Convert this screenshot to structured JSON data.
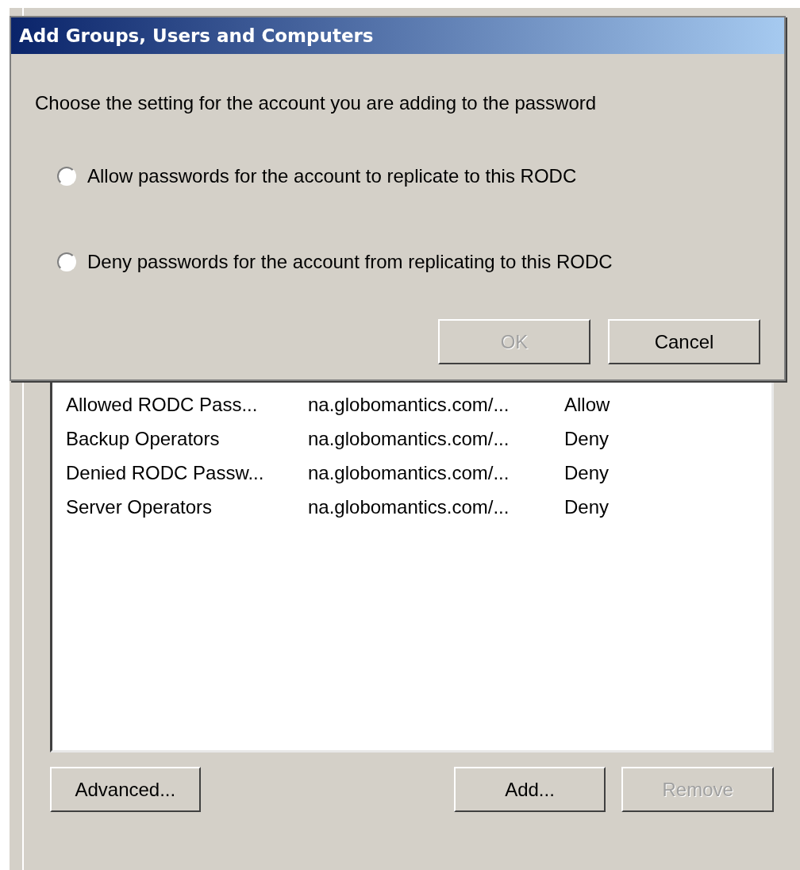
{
  "dialog": {
    "title": "Add Groups, Users and Computers",
    "prompt": "Choose the setting for the account you are adding to the password",
    "options": [
      {
        "label": "Allow passwords for the account to replicate to this RODC",
        "selected": false
      },
      {
        "label": "Deny passwords for the account from replicating to this RODC",
        "selected": false
      }
    ],
    "buttons": [
      {
        "label": "OK",
        "disabled": true
      },
      {
        "label": "Cancel",
        "disabled": false
      }
    ]
  },
  "list": {
    "rows": [
      {
        "name": "Allowed RODC Pass...",
        "domain": "na.globomantics.com/...",
        "setting": "Allow"
      },
      {
        "name": "Backup Operators",
        "domain": "na.globomantics.com/...",
        "setting": "Deny"
      },
      {
        "name": "Denied RODC Passw...",
        "domain": "na.globomantics.com/...",
        "setting": "Deny"
      },
      {
        "name": "Server Operators",
        "domain": "na.globomantics.com/...",
        "setting": "Deny"
      }
    ]
  },
  "buttons": [
    {
      "label": "Advanced...",
      "disabled": false
    },
    {
      "label": "Add...",
      "disabled": false
    },
    {
      "label": "Remove",
      "disabled": true
    }
  ]
}
